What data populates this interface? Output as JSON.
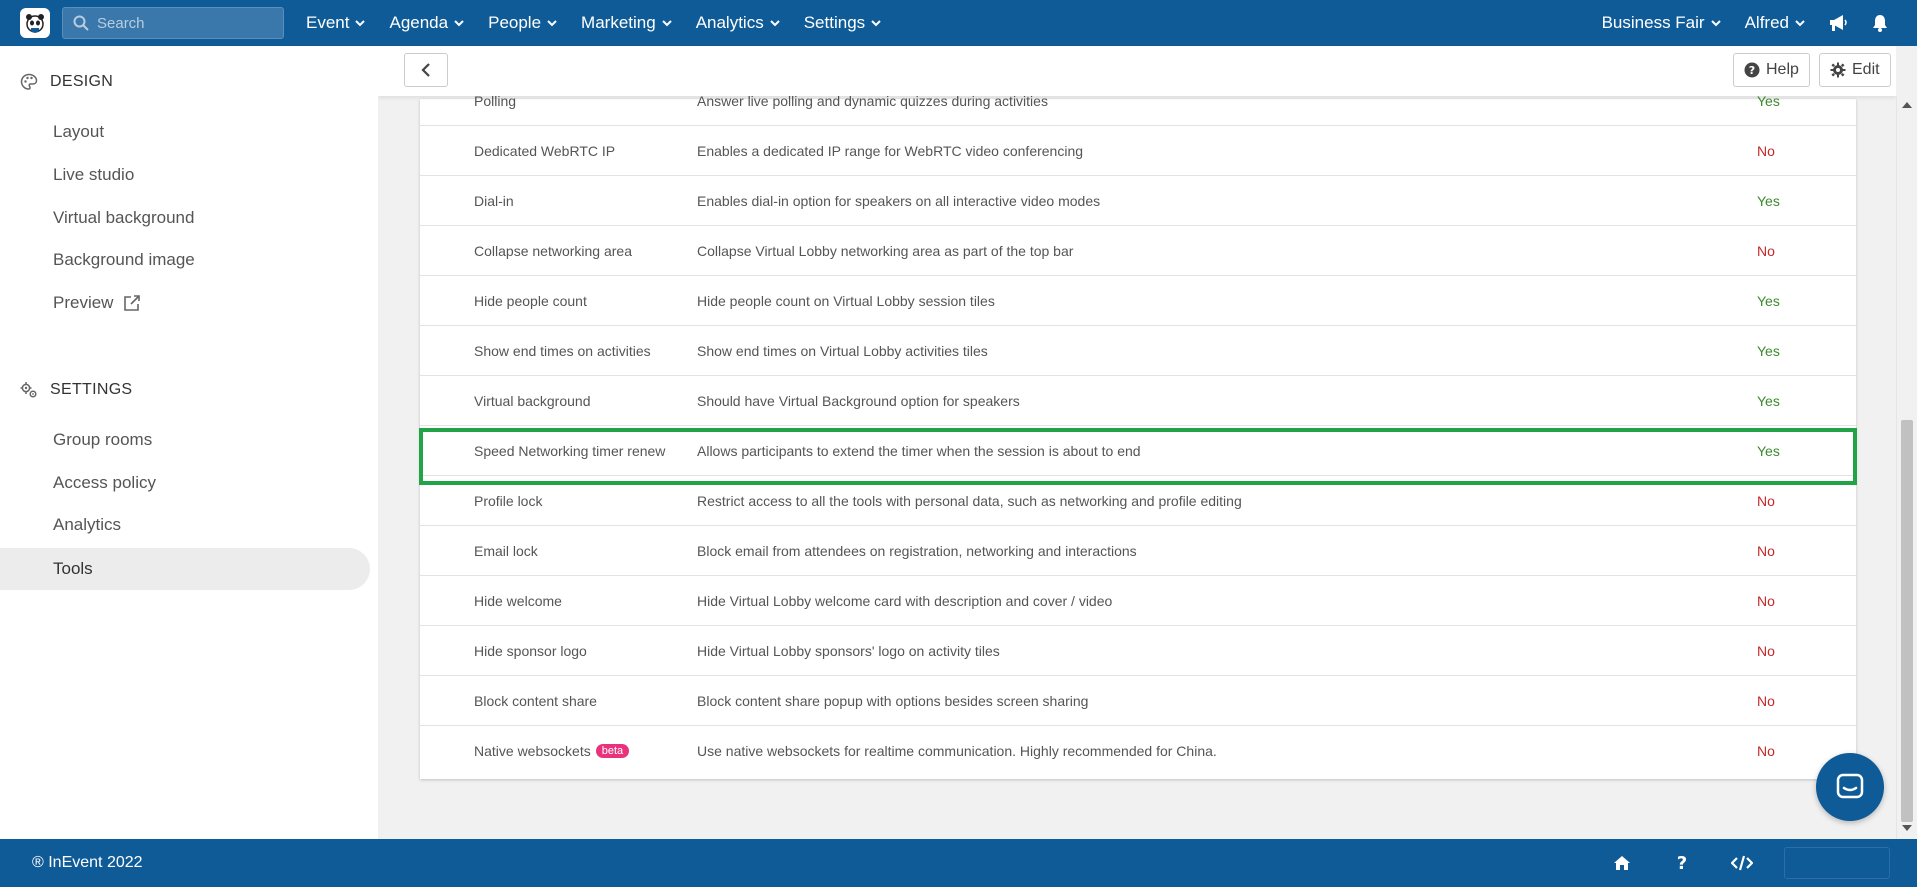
{
  "topbar": {
    "search_placeholder": "Search",
    "nav": [
      "Event",
      "Agenda",
      "People",
      "Marketing",
      "Analytics",
      "Settings"
    ],
    "event_name": "Business Fair",
    "user_name": "Alfred"
  },
  "sidebar": {
    "design_heading": "DESIGN",
    "design_items": [
      "Layout",
      "Live studio",
      "Virtual background",
      "Background image",
      "Preview"
    ],
    "settings_heading": "SETTINGS",
    "settings_items": [
      "Group rooms",
      "Access policy",
      "Analytics",
      "Tools"
    ],
    "active_item": "Tools"
  },
  "toolbar": {
    "help_label": "Help",
    "edit_label": "Edit"
  },
  "tools": {
    "rows": [
      {
        "name": "Polling",
        "description": "Answer live polling and dynamic quizzes during activities",
        "value": "Yes"
      },
      {
        "name": "Dedicated WebRTC IP",
        "description": "Enables a dedicated IP range for WebRTC video conferencing",
        "value": "No"
      },
      {
        "name": "Dial-in",
        "description": "Enables dial-in option for speakers on all interactive video modes",
        "value": "Yes"
      },
      {
        "name": "Collapse networking area",
        "description": "Collapse Virtual Lobby networking area as part of the top bar",
        "value": "No"
      },
      {
        "name": "Hide people count",
        "description": "Hide people count on Virtual Lobby session tiles",
        "value": "Yes"
      },
      {
        "name": "Show end times on activities",
        "description": "Show end times on Virtual Lobby activities tiles",
        "value": "Yes"
      },
      {
        "name": "Virtual background",
        "description": "Should have Virtual Background option for speakers",
        "value": "Yes"
      },
      {
        "name": "Speed Networking timer renew",
        "description": "Allows participants to extend the timer when the session is about to end",
        "value": "Yes"
      },
      {
        "name": "Profile lock",
        "description": "Restrict access to all the tools with personal data, such as networking and profile editing",
        "value": "No"
      },
      {
        "name": "Email lock",
        "description": "Block email from attendees on registration, networking and interactions",
        "value": "No"
      },
      {
        "name": "Hide welcome",
        "description": "Hide Virtual Lobby welcome card with description and cover / video",
        "value": "No"
      },
      {
        "name": "Hide sponsor logo",
        "description": "Hide Virtual Lobby sponsors' logo on activity tiles",
        "value": "No"
      },
      {
        "name": "Block content share",
        "description": "Block content share popup with options besides screen sharing",
        "value": "No"
      },
      {
        "name": "Native websockets",
        "badge": "beta",
        "description": "Use native websockets for realtime communication. Highly recommended for China.",
        "value": "No"
      }
    ]
  },
  "footer": {
    "copyright": "® InEvent 2022"
  },
  "colors": {
    "brand": "#0f5b97",
    "yes": "#3c8a2e",
    "no": "#c62828",
    "highlight": "#22a348",
    "badge": "#e8337c"
  }
}
